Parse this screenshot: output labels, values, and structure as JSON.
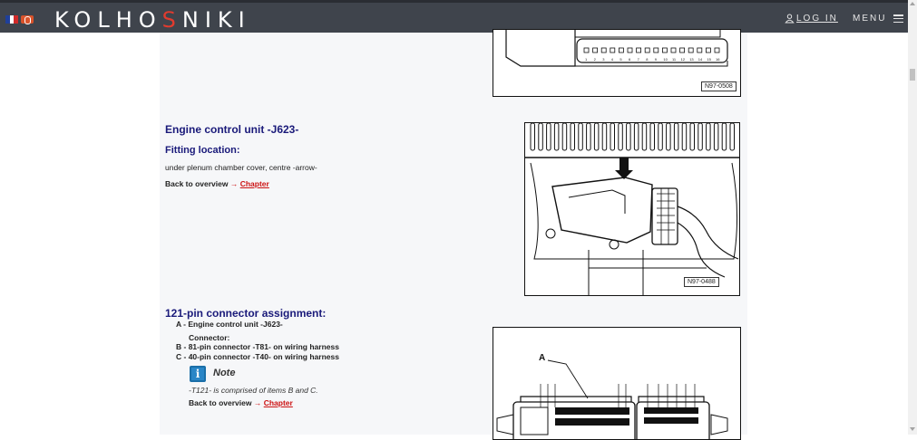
{
  "header": {
    "logo_pre": "KOLHO",
    "logo_accent": "S",
    "logo_post": "NIKI",
    "login_label": "LOG IN",
    "menu_label": "MENU",
    "colors": {
      "bar": "#3f444c",
      "accent": "#e23b2e"
    }
  },
  "figures": {
    "top_label": "N97-0508",
    "ecu_label": "N97-0488",
    "connector_label": "A"
  },
  "ecu_section": {
    "title": "Engine control unit -J623-",
    "fitting_heading": "Fitting location:",
    "fitting_text": "under plenum chamber cover, centre -arrow-",
    "back_text": "Back to overview",
    "arrow": "→",
    "link_text": "Chapter"
  },
  "connector_section": {
    "title": "121-pin connector assignment:",
    "item_a": "A - Engine control unit -J623-",
    "connector_label": "Connector:",
    "item_b": "B - 81-pin connector -T81- on wiring harness",
    "item_c": "C - 40-pin connector -T40- on wiring harness",
    "note_title": "Note",
    "note_icon": "info-icon",
    "note_text": "-T121- is comprised of items B and C.",
    "back_text": "Back to overview",
    "arrow": "→",
    "link_text": "Chapter"
  },
  "top_connector_numbers": [
    "1",
    "2",
    "3",
    "4",
    "5",
    "6",
    "7",
    "8",
    "9",
    "10",
    "11",
    "12",
    "13",
    "14",
    "15",
    "16"
  ]
}
